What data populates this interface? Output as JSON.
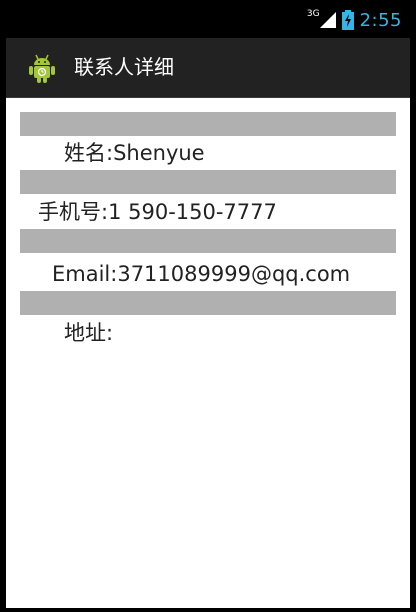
{
  "status_bar": {
    "network_type": "3G",
    "time": "2:55",
    "signal_icon": "signal-bars-icon",
    "battery_icon": "battery-charging-icon",
    "accent_color": "#33b5e5"
  },
  "action_bar": {
    "app_icon": "android-robot-icon",
    "title": "联系人详细"
  },
  "contact": {
    "name_line": "姓名:Shenyue",
    "phone_line": "手机号:1 590-150-7777",
    "email_line": "Email:3711089999@qq.com",
    "address_line": "地址:"
  },
  "colors": {
    "divider": "#b0b0b0",
    "background": "#ffffff",
    "action_bar": "#222222"
  }
}
